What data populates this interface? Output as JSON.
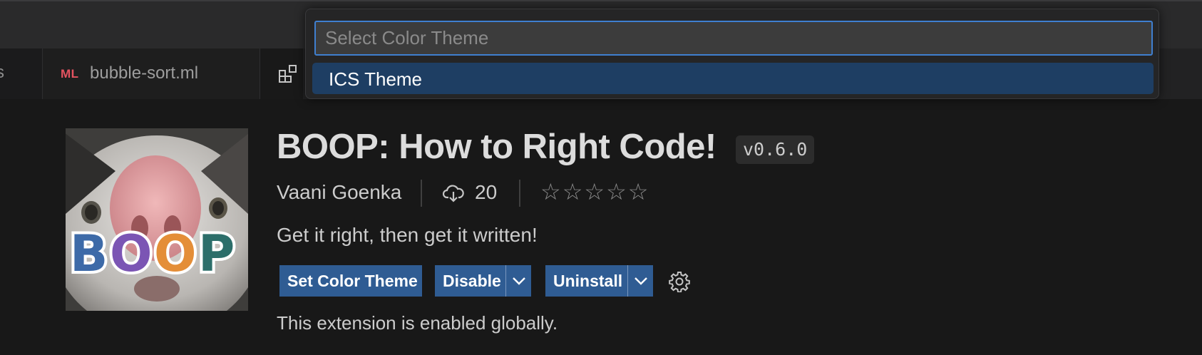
{
  "tabs": {
    "partial_label": "s",
    "file_tab": {
      "badge": "ML",
      "label": "bubble-sort.ml"
    }
  },
  "quick_pick": {
    "placeholder": "Select Color Theme",
    "items": [
      {
        "label": "ICS Theme"
      }
    ]
  },
  "extension": {
    "banner_text": "BOOP",
    "title": "BOOP: How to Right Code!",
    "version": "v0.6.0",
    "publisher": "Vaani Goenka",
    "downloads": "20",
    "rating_stars": "☆☆☆☆☆",
    "rating_value": 0,
    "description": "Get it right, then get it written!",
    "buttons": {
      "set_color_theme": "Set Color Theme",
      "disable": "Disable",
      "uninstall": "Uninstall"
    },
    "status": "This extension is enabled globally."
  },
  "colors": {
    "background": "#181818",
    "accent_button": "#2f5c93",
    "focus_border": "#3f7fd0",
    "selected_item": "#1e3e63",
    "ml_badge": "#e45360"
  },
  "icons": [
    "extensions-icon",
    "download-cloud-icon",
    "gear-icon",
    "chevron-down-icon"
  ]
}
